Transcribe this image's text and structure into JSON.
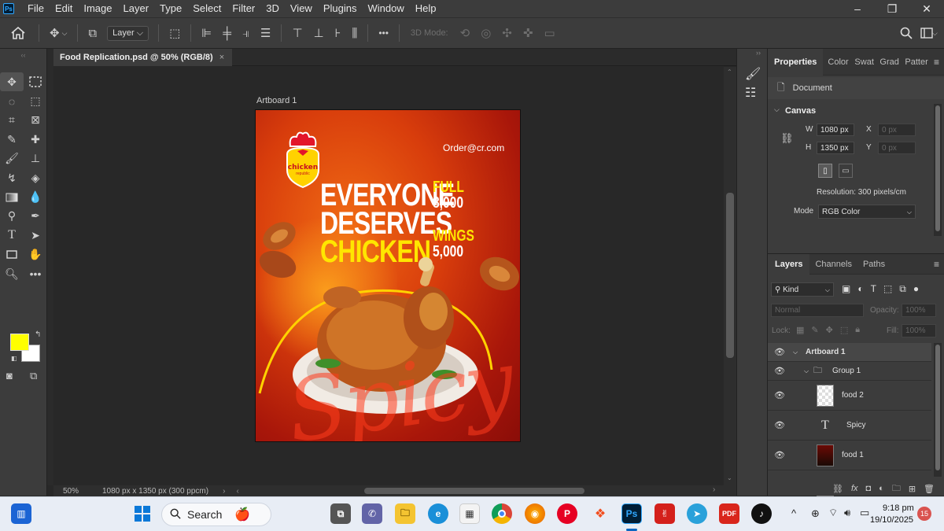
{
  "app": {
    "logo": "Ps",
    "menu": [
      "File",
      "Edit",
      "Image",
      "Layer",
      "Type",
      "Select",
      "Filter",
      "3D",
      "View",
      "Plugins",
      "Window",
      "Help"
    ],
    "window_controls": [
      "–",
      "❐",
      "✕"
    ]
  },
  "options_bar": {
    "layer_select": "Layer",
    "mode_3d_label": "3D Mode:",
    "more_label": "•••"
  },
  "document": {
    "tab_title": "Food Replication.psd @ 50% (RGB/8)",
    "tab_close": "×",
    "artboard_label": "Artboard 1",
    "zoom": "50%",
    "doc_size": "1080 px x 1350 px (300 ppcm)"
  },
  "poster": {
    "email": "Order@cr.com",
    "logo_text": "chicken",
    "logo_sub": "republic",
    "headline": [
      "EVERYONE",
      "DESERVES",
      "CHICKEN"
    ],
    "offer1_label": "FULL",
    "offer1_price": "8,000",
    "offer2_label": "WINGS",
    "offer2_price": "5,000",
    "script_word": "Spicy",
    "colors": {
      "bg_light": "#f06a14",
      "bg_dark": "#8a0d08",
      "headline": "#ffffff",
      "accent": "#ffe600"
    }
  },
  "properties": {
    "tabs": [
      "Properties",
      "Color",
      "Swat",
      "Grad",
      "Patter"
    ],
    "section_document": "Document",
    "section_canvas": "Canvas",
    "w_label": "W",
    "w_value": "1080 px",
    "h_label": "H",
    "h_value": "1350 px",
    "x_label": "X",
    "x_placeholder": "0 px",
    "y_label": "Y",
    "y_placeholder": "0 px",
    "resolution": "Resolution: 300 pixels/cm",
    "mode_label": "Mode",
    "mode_value": "RGB Color"
  },
  "layers": {
    "tabs": [
      "Layers",
      "Channels",
      "Paths"
    ],
    "kind_filter": "Kind",
    "blend_mode": "Normal",
    "opacity_label": "Opacity:",
    "opacity_value": "100%",
    "lock_label": "Lock:",
    "fill_label": "Fill:",
    "fill_value": "100%",
    "items": [
      {
        "name": "Artboard 1",
        "type": "artboard"
      },
      {
        "name": "Group 1",
        "type": "group"
      },
      {
        "name": "food 2",
        "type": "image"
      },
      {
        "name": "Spicy",
        "type": "text"
      },
      {
        "name": "food 1",
        "type": "image"
      }
    ]
  },
  "taskbar": {
    "search_label": "Search",
    "time": "9:18 pm",
    "date": "19/10/2025",
    "notification_count": "15",
    "pdf_label": "PDF",
    "ps_label": "Ps"
  }
}
